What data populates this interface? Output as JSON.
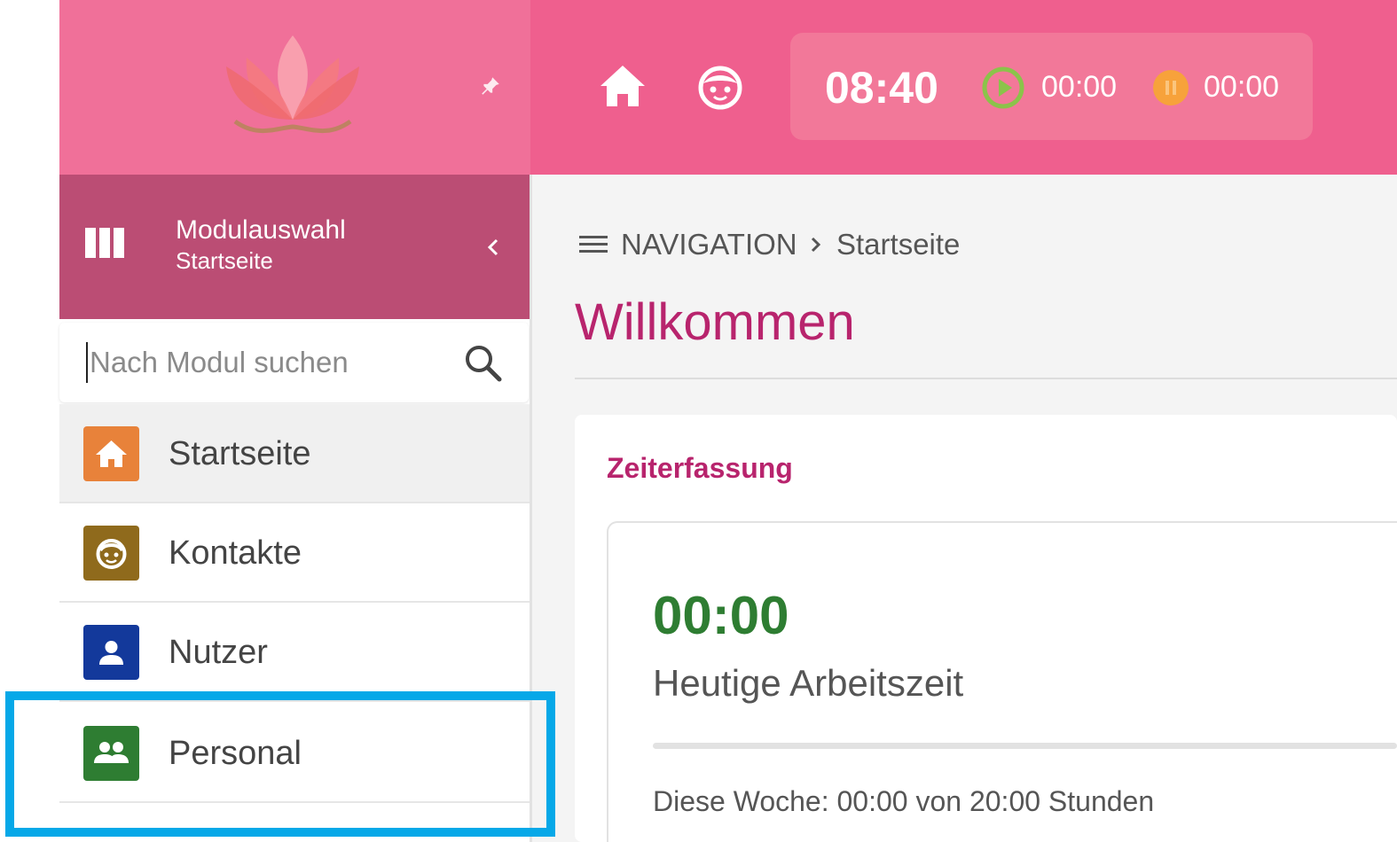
{
  "header": {
    "clock": "08:40",
    "work_time": "00:00",
    "pause_time": "00:00",
    "home_icon": "home-icon",
    "contacts_icon": "contacts-face-icon",
    "play_icon": "play-circle-icon",
    "pause_icon": "pause-circle-icon"
  },
  "sidebar": {
    "logo": "lotus-logo",
    "module_switcher": {
      "title": "Modulauswahl",
      "subtitle": "Startseite"
    },
    "search": {
      "value": "",
      "placeholder": "Nach Modul suchen"
    },
    "items": [
      {
        "label": "Startseite",
        "icon": "home-icon",
        "color": "#e8823a",
        "active": true
      },
      {
        "label": "Kontakte",
        "icon": "contacts-face-icon",
        "color": "#8f6a1c",
        "active": false
      },
      {
        "label": "Nutzer",
        "icon": "user-icon",
        "color": "#13399b",
        "active": false
      },
      {
        "label": "Personal",
        "icon": "group-icon",
        "color": "#2e7d32",
        "active": false
      }
    ]
  },
  "breadcrumb": {
    "root": "NAVIGATION",
    "current": "Startseite"
  },
  "main": {
    "title": "Willkommen",
    "card": {
      "title": "Zeiterfassung",
      "today_time": "00:00",
      "today_label": "Heutige Arbeitszeit",
      "week_progress": 0,
      "week_summary": "Diese Woche: 00:00 von 20:00 Stunden"
    }
  },
  "colors": {
    "brand_pink": "#ef5f8e",
    "sidebar_header": "#bb4d74",
    "title_accent": "#b8246d",
    "success_green": "#2e7d32",
    "highlight": "#06a8e8"
  }
}
